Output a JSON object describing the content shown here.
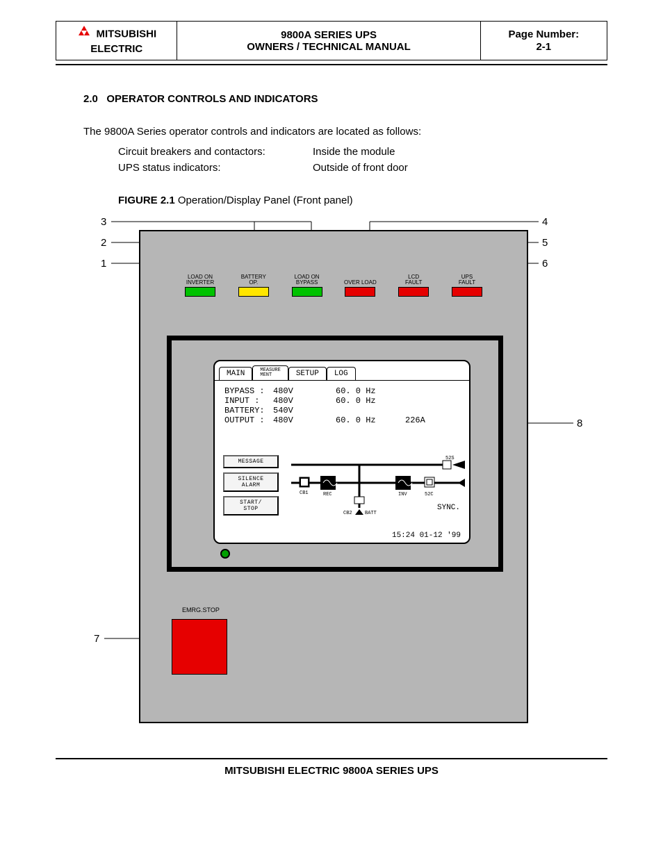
{
  "header": {
    "company_line1": "MITSUBISHI",
    "company_line2": "ELECTRIC",
    "title_line1": "9800A SERIES UPS",
    "title_line2": "OWNERS / TECHNICAL MANUAL",
    "page_label": "Page Number:",
    "page_number": "2-1"
  },
  "section": {
    "number": "2.0",
    "title": "OPERATOR CONTROLS AND INDICATORS",
    "intro": "The 9800A Series operator controls and indicators are located as follows:",
    "rows": [
      {
        "label": "Circuit breakers and contactors:",
        "value": "Inside the module"
      },
      {
        "label": "UPS status indicators:",
        "value": "Outside of front door"
      }
    ],
    "figure_label": "FIGURE 2.1",
    "figure_caption": "Operation/Display Panel (Front panel)"
  },
  "leds": [
    {
      "l1": "LOAD ON",
      "l2": "INVERTER",
      "color": "green"
    },
    {
      "l1": "BATTERY",
      "l2": "OP.",
      "color": "yellow"
    },
    {
      "l1": "LOAD ON",
      "l2": "BYPASS",
      "color": "green"
    },
    {
      "l1": "",
      "l2": "OVER LOAD",
      "color": "red"
    },
    {
      "l1": "LCD",
      "l2": "FAULT",
      "color": "red"
    },
    {
      "l1": "UPS",
      "l2": "FAULT",
      "color": "red"
    }
  ],
  "screen": {
    "tabs": [
      "MAIN",
      "MEASURE\nMENT",
      "SETUP",
      "LOG"
    ],
    "readings": [
      {
        "label": "BYPASS :",
        "v": "480V",
        "hz": "60. 0 Hz",
        "a": ""
      },
      {
        "label": "INPUT  :",
        "v": "480V",
        "hz": "60. 0 Hz",
        "a": ""
      },
      {
        "label": "BATTERY:",
        "v": "540V",
        "hz": "",
        "a": ""
      },
      {
        "label": "OUTPUT :",
        "v": "480V",
        "hz": "60. 0 Hz",
        "a": "226A"
      }
    ],
    "buttons": [
      "MESSAGE",
      "SILENCE\nALARM",
      "START/\nSTOP"
    ],
    "diagram_labels": {
      "cb1": "CB1",
      "rec": "REC",
      "inv": "INV",
      "s52s": "52S",
      "s52c": "52C",
      "cb2": "CB2",
      "batt": "BATT",
      "sync": "SYNC."
    },
    "timestamp": "15:24 01-12 '99"
  },
  "emrg": {
    "label": "EMRG.STOP"
  },
  "callouts": {
    "1": "1",
    "2": "2",
    "3": "3",
    "4": "4",
    "5": "5",
    "6": "6",
    "7": "7",
    "8": "8"
  },
  "footer": "MITSUBISHI ELECTRIC 9800A SERIES UPS"
}
